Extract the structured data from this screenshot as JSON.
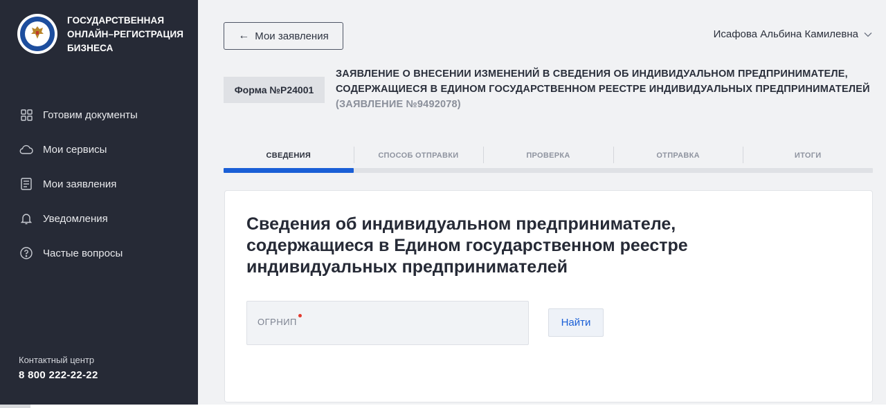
{
  "brand": {
    "lines": [
      "ГОСУДАРСТВЕННАЯ",
      "ОНЛАЙН–РЕГИСТРАЦИЯ",
      "БИЗНЕСА"
    ],
    "logo_icon": "fns-emblem-icon"
  },
  "sidebar": {
    "items": [
      {
        "label": "Готовим документы",
        "icon": "grid-icon"
      },
      {
        "label": "Мои сервисы",
        "icon": "cloud-icon"
      },
      {
        "label": "Мои заявления",
        "icon": "document-list-icon"
      },
      {
        "label": "Уведомления",
        "icon": "bell-icon"
      },
      {
        "label": "Частые вопросы",
        "icon": "question-circle-icon"
      }
    ],
    "contact_label": "Контактный центр",
    "contact_phone": "8 800 222-22-22"
  },
  "header": {
    "back_label": "Мои заявления",
    "user_name": "Исафова Альбина Камилевна"
  },
  "form": {
    "badge": "Форма №Р24001",
    "title": "ЗАЯВЛЕНИЕ О ВНЕСЕНИИ ИЗМЕНЕНИЙ В СВЕДЕНИЯ ОБ ИНДИВИДУАЛЬНОМ ПРЕДПРИНИМАТЕЛЕ, СОДЕРЖАЩИЕСЯ В ЕДИНОМ ГОСУДАРСТВЕННОМ РЕЕСТРЕ ИНДИВИДУАЛЬНЫХ ПРЕДПРИНИМАТЕЛЕЙ",
    "number": "(ЗАЯВЛЕНИЕ №9492078)"
  },
  "tabs": [
    {
      "label": "СВЕДЕНИЯ",
      "active": true
    },
    {
      "label": "СПОСОБ ОТПРАВКИ",
      "active": false
    },
    {
      "label": "ПРОВЕРКА",
      "active": false
    },
    {
      "label": "ОТПРАВКА",
      "active": false
    },
    {
      "label": "ИТОГИ",
      "active": false
    }
  ],
  "progress": {
    "step": 1,
    "total": 5,
    "fraction": 0.2,
    "color": "#1a5fd6"
  },
  "card": {
    "title": "Сведения об индивидуальном предпринимателе, содержащиеся в Едином государственном реестре индивидуальных предпринимателей",
    "ogrnip_label": "ОГРНИП",
    "ogrnip_value": "",
    "find_label": "Найти"
  },
  "colors": {
    "sidebar_bg": "#262a36",
    "accent": "#1a5fd6",
    "required": "#e23a2e"
  }
}
